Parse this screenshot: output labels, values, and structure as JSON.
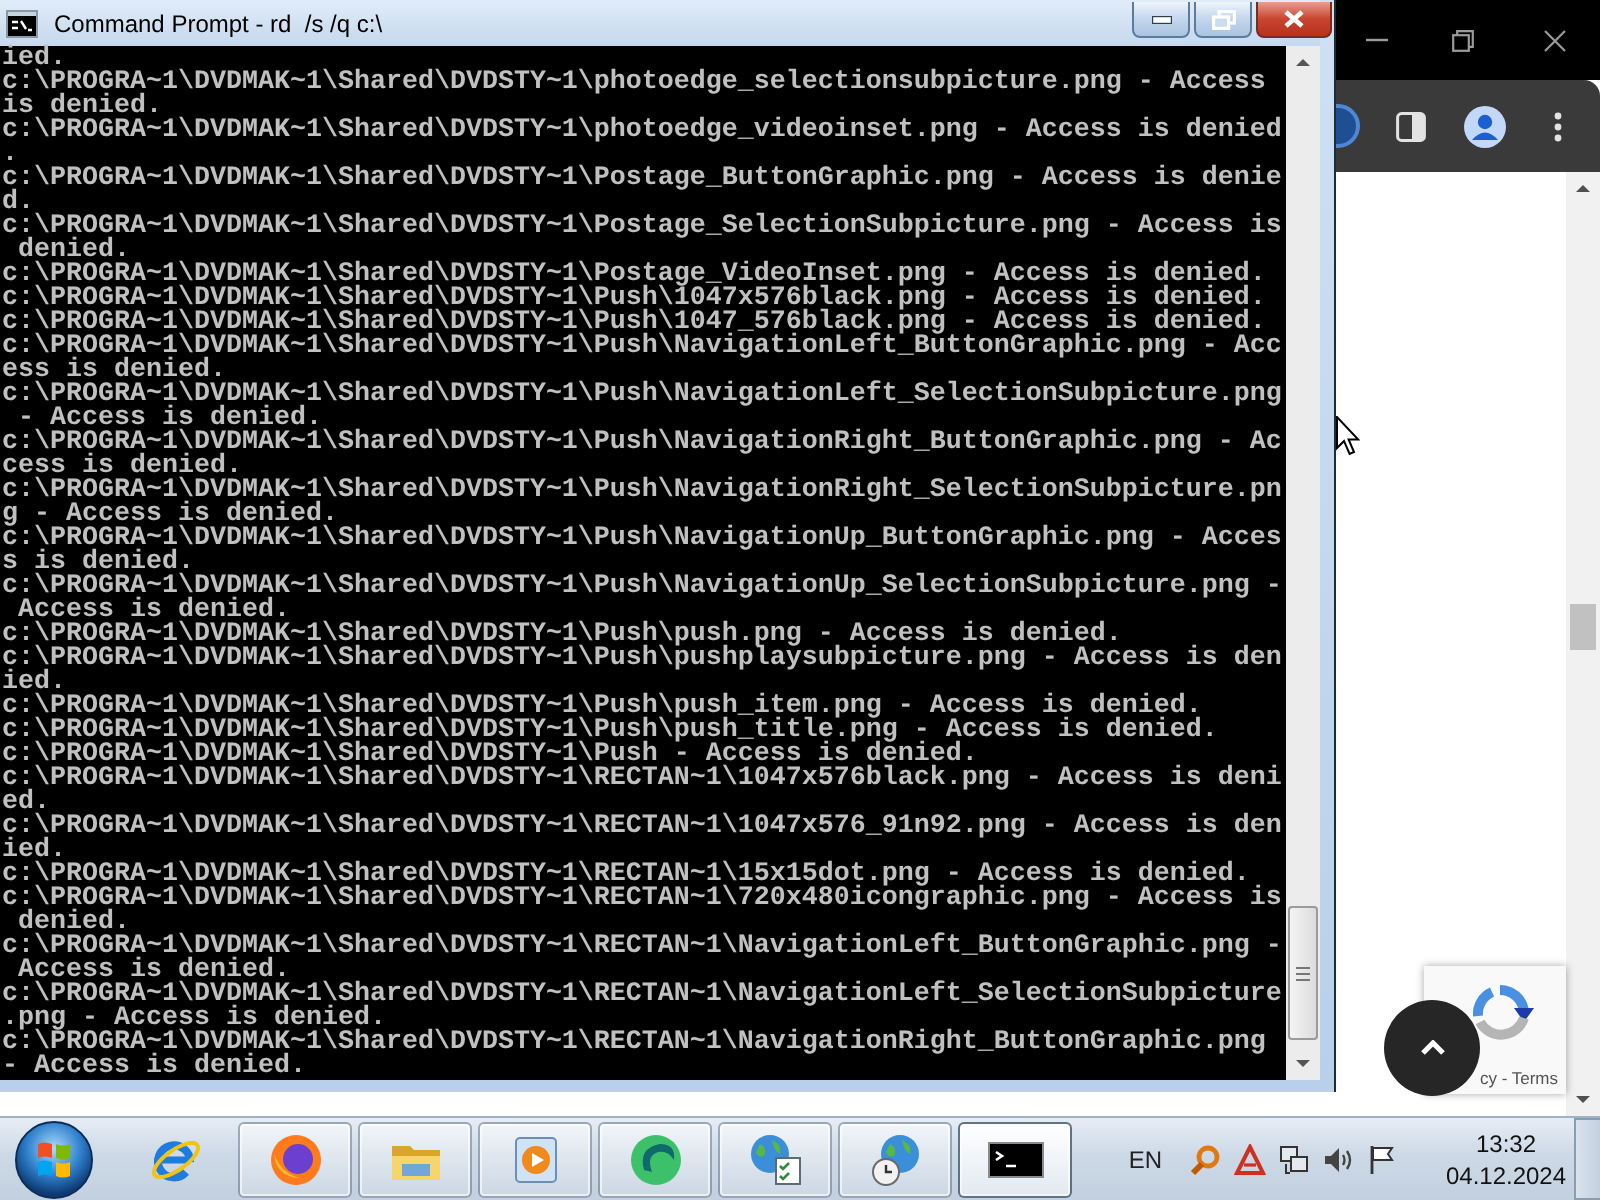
{
  "command_window": {
    "title": "Command Prompt - rd  /s /q c:\\",
    "lines": [
      "ied.",
      "c:\\PROGRA~1\\DVDMAK~1\\Shared\\DVDSTY~1\\photoedge_selectionsubpicture.png - Access",
      "is denied.",
      "c:\\PROGRA~1\\DVDMAK~1\\Shared\\DVDSTY~1\\photoedge_videoinset.png - Access is denied",
      ".",
      "c:\\PROGRA~1\\DVDMAK~1\\Shared\\DVDSTY~1\\Postage_ButtonGraphic.png - Access is denie",
      "d.",
      "c:\\PROGRA~1\\DVDMAK~1\\Shared\\DVDSTY~1\\Postage_SelectionSubpicture.png - Access is",
      " denied.",
      "c:\\PROGRA~1\\DVDMAK~1\\Shared\\DVDSTY~1\\Postage_VideoInset.png - Access is denied.",
      "c:\\PROGRA~1\\DVDMAK~1\\Shared\\DVDSTY~1\\Push\\1047x576black.png - Access is denied.",
      "c:\\PROGRA~1\\DVDMAK~1\\Shared\\DVDSTY~1\\Push\\1047_576black.png - Access is denied.",
      "c:\\PROGRA~1\\DVDMAK~1\\Shared\\DVDSTY~1\\Push\\NavigationLeft_ButtonGraphic.png - Acc",
      "ess is denied.",
      "c:\\PROGRA~1\\DVDMAK~1\\Shared\\DVDSTY~1\\Push\\NavigationLeft_SelectionSubpicture.png",
      " - Access is denied.",
      "c:\\PROGRA~1\\DVDMAK~1\\Shared\\DVDSTY~1\\Push\\NavigationRight_ButtonGraphic.png - Ac",
      "cess is denied.",
      "c:\\PROGRA~1\\DVDMAK~1\\Shared\\DVDSTY~1\\Push\\NavigationRight_SelectionSubpicture.pn",
      "g - Access is denied.",
      "c:\\PROGRA~1\\DVDMAK~1\\Shared\\DVDSTY~1\\Push\\NavigationUp_ButtonGraphic.png - Acces",
      "s is denied.",
      "c:\\PROGRA~1\\DVDMAK~1\\Shared\\DVDSTY~1\\Push\\NavigationUp_SelectionSubpicture.png -",
      " Access is denied.",
      "c:\\PROGRA~1\\DVDMAK~1\\Shared\\DVDSTY~1\\Push\\push.png - Access is denied.",
      "c:\\PROGRA~1\\DVDMAK~1\\Shared\\DVDSTY~1\\Push\\pushplaysubpicture.png - Access is den",
      "ied.",
      "c:\\PROGRA~1\\DVDMAK~1\\Shared\\DVDSTY~1\\Push\\push_item.png - Access is denied.",
      "c:\\PROGRA~1\\DVDMAK~1\\Shared\\DVDSTY~1\\Push\\push_title.png - Access is denied.",
      "c:\\PROGRA~1\\DVDMAK~1\\Shared\\DVDSTY~1\\Push - Access is denied.",
      "c:\\PROGRA~1\\DVDMAK~1\\Shared\\DVDSTY~1\\RECTAN~1\\1047x576black.png - Access is deni",
      "ed.",
      "c:\\PROGRA~1\\DVDMAK~1\\Shared\\DVDSTY~1\\RECTAN~1\\1047x576_91n92.png - Access is den",
      "ied.",
      "c:\\PROGRA~1\\DVDMAK~1\\Shared\\DVDSTY~1\\RECTAN~1\\15x15dot.png - Access is denied.",
      "c:\\PROGRA~1\\DVDMAK~1\\Shared\\DVDSTY~1\\RECTAN~1\\720x480icongraphic.png - Access is",
      " denied.",
      "c:\\PROGRA~1\\DVDMAK~1\\Shared\\DVDSTY~1\\RECTAN~1\\NavigationLeft_ButtonGraphic.png -",
      " Access is denied.",
      "c:\\PROGRA~1\\DVDMAK~1\\Shared\\DVDSTY~1\\RECTAN~1\\NavigationLeft_SelectionSubpicture",
      ".png - Access is denied.",
      "c:\\PROGRA~1\\DVDMAK~1\\Shared\\DVDSTY~1\\RECTAN~1\\NavigationRight_ButtonGraphic.png",
      "- Access is denied."
    ]
  },
  "browser": {
    "privacy_badge": {
      "text": "cy - Terms"
    }
  },
  "taskbar": {
    "apps": [
      {
        "kind": "ie",
        "running": false,
        "selected": false
      },
      {
        "kind": "firefox",
        "running": true,
        "selected": false
      },
      {
        "kind": "explorer",
        "running": true,
        "selected": false
      },
      {
        "kind": "media",
        "running": true,
        "selected": false
      },
      {
        "kind": "green-app",
        "running": true,
        "selected": false
      },
      {
        "kind": "network",
        "running": true,
        "selected": false
      },
      {
        "kind": "globe-clock",
        "running": true,
        "selected": false
      },
      {
        "kind": "console",
        "running": true,
        "selected": true
      }
    ],
    "language": "EN",
    "time": "13:32",
    "date": "04.12.2024"
  }
}
